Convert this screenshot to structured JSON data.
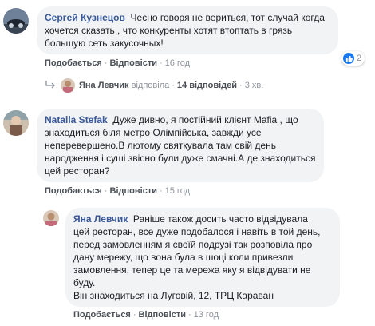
{
  "comments": [
    {
      "author": "Сергей Кузнецов",
      "lines": [
        "Чесно говоря не вериться, тот случай когда",
        "хочется сказать , что конкуренты хотят втоптать в грязь",
        "большую сеть закусочных!"
      ],
      "like_label": "Подобається",
      "reply_label": "Відповісти",
      "time": "16 год",
      "reactions": "2",
      "replies_summary": {
        "author": "Яна Левчик",
        "verb": "відповіла",
        "count": "14 відповідей",
        "time": "3 хв."
      }
    },
    {
      "author": "Natalla Stefak",
      "first_line": "Дуже дивно, я постійний клієнт Mafia , що",
      "lines": [
        "знаходиться біля метро Олімпійська, завжди усе",
        "неперевершено.В лютому святкувала там свій день",
        "народження і суші звісно були дуже смачні.А де знаходиться",
        "цей ресторан?"
      ],
      "like_label": "Подобається",
      "reply_label": "Відповісти",
      "time": "15 год"
    }
  ],
  "reply": {
    "author": "Яна Левчик",
    "first_line": "Раніше також досить часто відвідувала",
    "lines": [
      "цей ресторан, все дуже подобалося і навіть в той день,",
      "перед замовленням я своїй подрузі так розповіла про",
      "дану мережу, що вона була в шоці коли привезли",
      "замовлення, тепер це та мережа яку я відвідувати не",
      "буду.",
      "Він знаходиться на Луговій, 12, ТРЦ Караван"
    ],
    "like_label": "Подобається",
    "reply_label": "Відповісти",
    "time": "13 год"
  },
  "separator": "·",
  "colors": {
    "name": "#385898",
    "bubble": "#f2f3f5",
    "like": "#1877f2"
  }
}
